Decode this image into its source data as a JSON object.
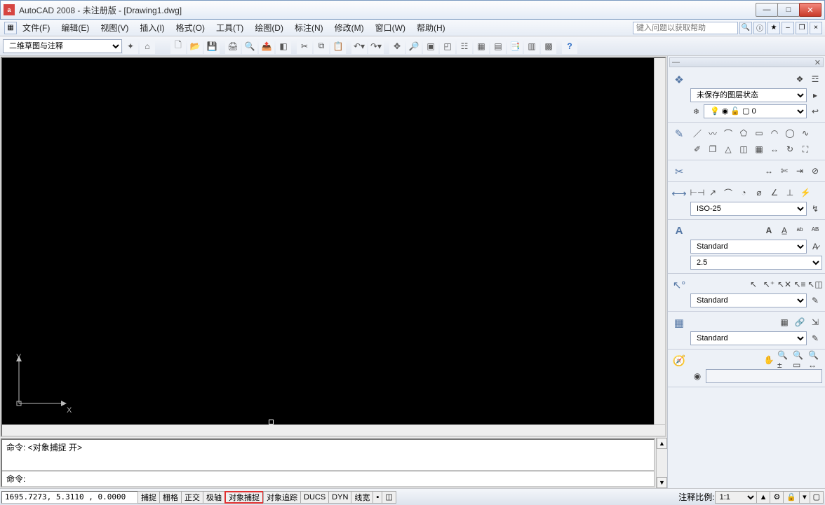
{
  "title": "AutoCAD 2008 - 未注册版 - [Drawing1.dwg]",
  "menu": {
    "file": "文件(F)",
    "edit": "编辑(E)",
    "view": "视图(V)",
    "insert": "插入(I)",
    "format": "格式(O)",
    "tools": "工具(T)",
    "draw": "绘图(D)",
    "dimension": "标注(N)",
    "modify": "修改(M)",
    "window": "窗口(W)",
    "help": "帮助(H)",
    "help_placeholder": "键入问题以获取帮助"
  },
  "workspace": {
    "selected": "二维草图与注释"
  },
  "layers": {
    "state": "未保存的图层状态",
    "current": "0"
  },
  "dim": {
    "style": "ISO-25"
  },
  "text": {
    "style": "Standard",
    "height": "2.5"
  },
  "leader": {
    "style": "Standard"
  },
  "table": {
    "style": "Standard"
  },
  "axis": {
    "x": "X",
    "y": "Y"
  },
  "cmd": {
    "history": "命令:  <对象捕捉 开>",
    "prompt": "命令:"
  },
  "status": {
    "coords": "1695.7273, 5.3110 , 0.0000",
    "snap": "捕捉",
    "grid": "栅格",
    "ortho": "正交",
    "polar": "极轴",
    "osnap": "对象捕捉",
    "otrack": "对象追踪",
    "ducs": "DUCS",
    "dyn": "DYN",
    "lwt": "线宽",
    "scale_label": "注释比例:",
    "scale": "1:1"
  }
}
